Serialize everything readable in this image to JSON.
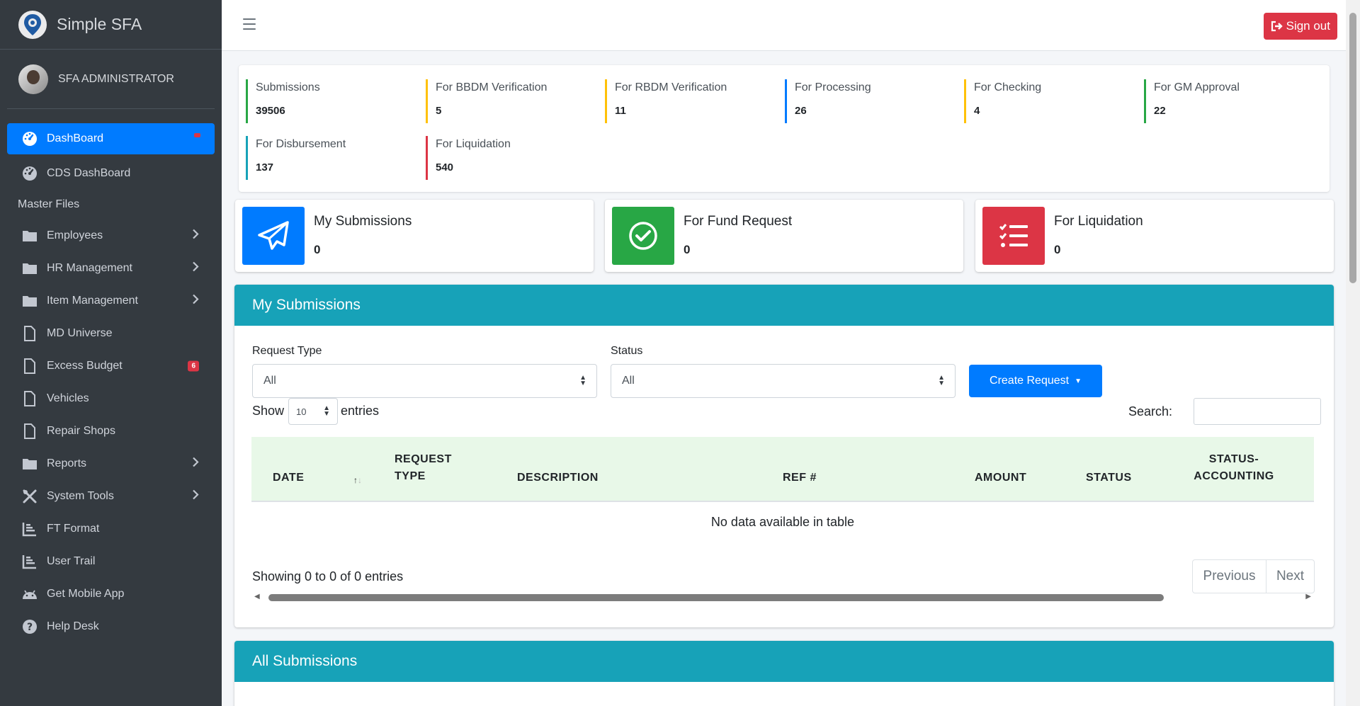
{
  "app": {
    "brand": "Simple SFA",
    "user": "SFA ADMINISTRATOR",
    "sign_out": "Sign out"
  },
  "sidebar": {
    "items": [
      {
        "label": "DashBoard",
        "icon": "dashboard-gauge-icon"
      },
      {
        "label": "CDS DashBoard",
        "icon": "dashboard-gauge-icon"
      }
    ],
    "section_header": "Master Files",
    "master_items": [
      {
        "label": "Employees",
        "icon": "folder-icon"
      },
      {
        "label": "HR Management",
        "icon": "folder-icon"
      },
      {
        "label": "Item Management",
        "icon": "folder-icon"
      },
      {
        "label": "MD Universe",
        "icon": "file-icon"
      },
      {
        "label": "Excess Budget",
        "icon": "file-icon",
        "badge": "6"
      },
      {
        "label": "Vehicles",
        "icon": "file-icon"
      },
      {
        "label": "Repair Shops",
        "icon": "file-icon"
      },
      {
        "label": "Reports",
        "icon": "folder-icon"
      },
      {
        "label": "System Tools",
        "icon": "tools-icon"
      },
      {
        "label": "FT Format",
        "icon": "chart-icon"
      },
      {
        "label": "User Trail",
        "icon": "chart-icon"
      },
      {
        "label": "Get Mobile App",
        "icon": "android-icon"
      },
      {
        "label": "Help Desk",
        "icon": "question-icon"
      }
    ]
  },
  "stats": [
    {
      "label": "Submissions",
      "value": "39506",
      "color": "#28a745"
    },
    {
      "label": "For BBDM Verification",
      "value": "5",
      "color": "#ffc107"
    },
    {
      "label": "For RBDM Verification",
      "value": "11",
      "color": "#ffc107"
    },
    {
      "label": "For Processing",
      "value": "26",
      "color": "#007bff"
    },
    {
      "label": "For Checking",
      "value": "4",
      "color": "#ffc107"
    },
    {
      "label": "For GM Approval",
      "value": "22",
      "color": "#28a745"
    },
    {
      "label": "For Disbursement",
      "value": "137",
      "color": "#17a2b8"
    },
    {
      "label": "For Liquidation",
      "value": "540",
      "color": "#dc3545"
    }
  ],
  "info_boxes": [
    {
      "label": "My Submissions",
      "value": "0",
      "color": "#007bff",
      "icon": "paper-plane-icon"
    },
    {
      "label": "For Fund Request",
      "value": "0",
      "color": "#28a745",
      "icon": "check-circle-icon"
    },
    {
      "label": "For Liquidation",
      "value": "0",
      "color": "#dc3545",
      "icon": "tasks-list-icon"
    }
  ],
  "my_submissions": {
    "title": "My Submissions",
    "request_type_label": "Request Type",
    "request_type_value": "All",
    "status_label": "Status",
    "status_value": "All",
    "create_button": "Create Request",
    "show_label": "Show",
    "entries_value": "10",
    "entries_label": "entries",
    "search_label": "Search:",
    "columns": [
      "DATE",
      "REQUEST TYPE",
      "DESCRIPTION",
      "REF #",
      "AMOUNT",
      "STATUS",
      "STATUS- ACCOUNTING"
    ],
    "empty_text": "No data available in table",
    "info": "Showing 0 to 0 of 0 entries",
    "prev": "Previous",
    "next": "Next"
  },
  "all_submissions": {
    "title": "All Submissions"
  }
}
